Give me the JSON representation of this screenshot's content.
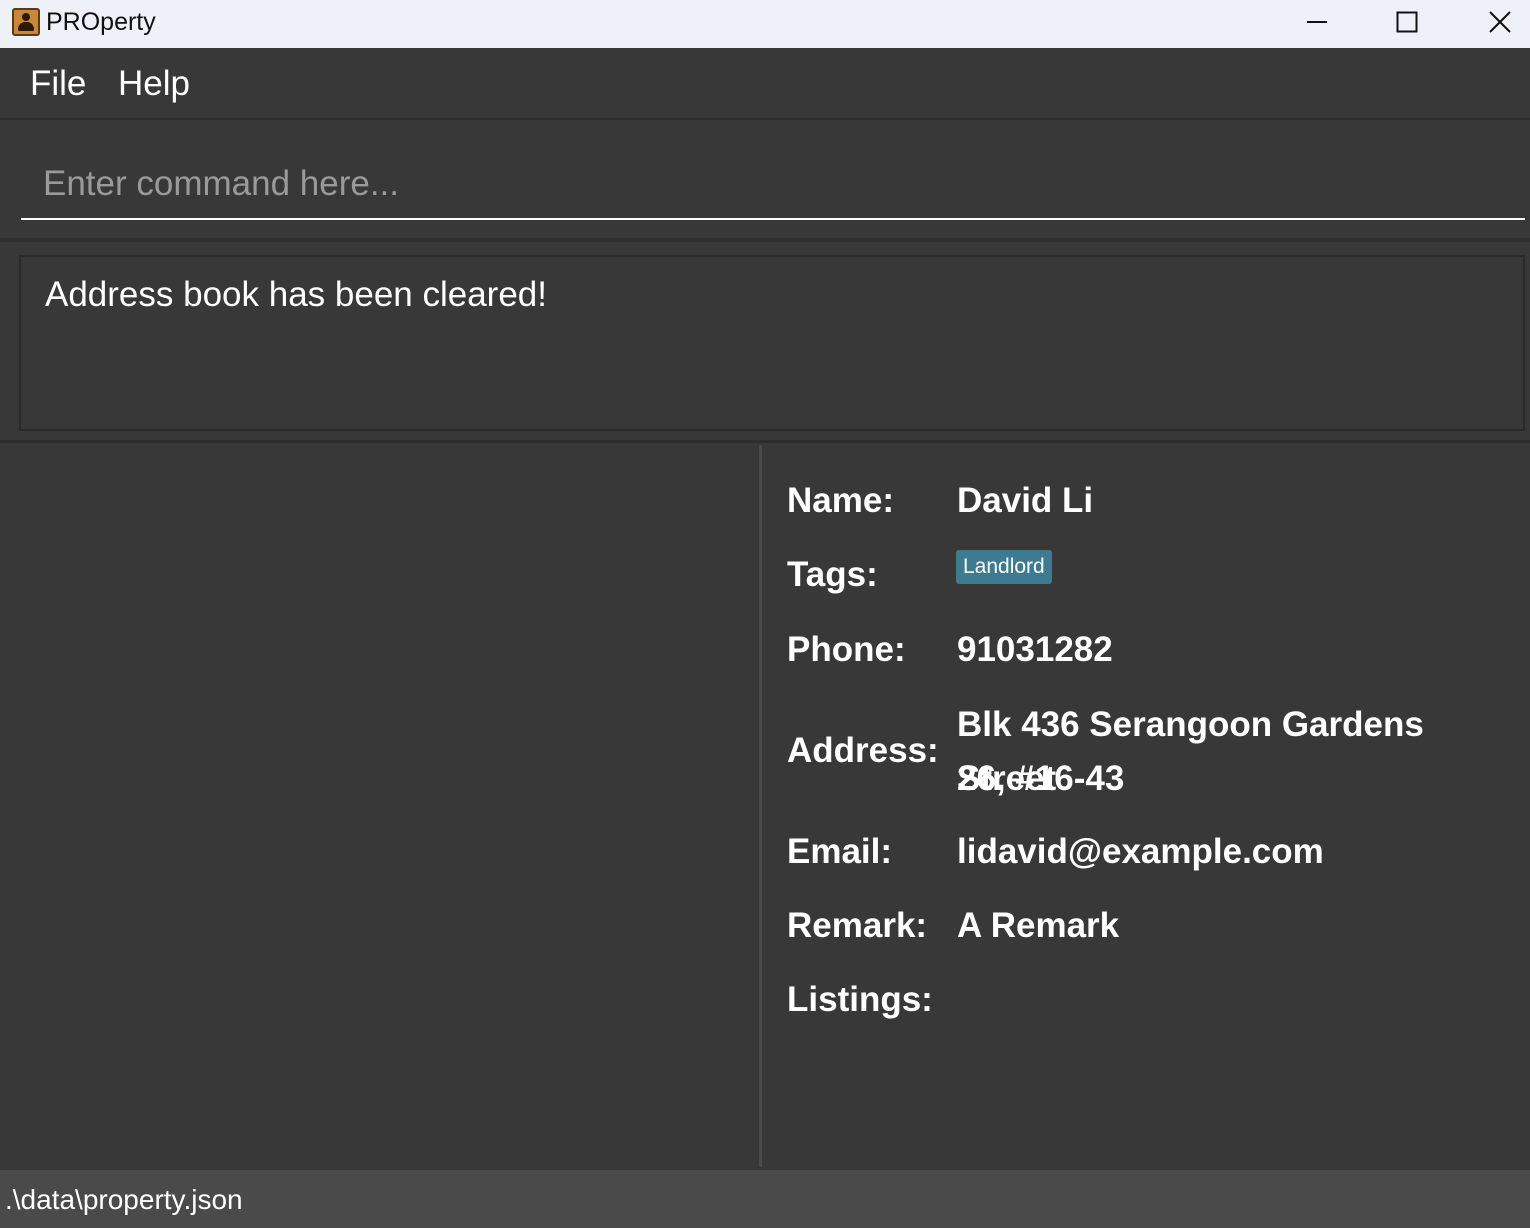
{
  "window": {
    "title": "PROperty",
    "icon": "address-book-icon",
    "controls": [
      "minimize-icon",
      "maximize-icon",
      "close-icon"
    ]
  },
  "menu": {
    "file": "File",
    "help": "Help"
  },
  "command": {
    "placeholder": "Enter command here...",
    "value": ""
  },
  "result": {
    "message": "Address book has been cleared!"
  },
  "person": {
    "labels": {
      "name": "Name:",
      "tags": "Tags:",
      "phone": "Phone:",
      "address": "Address:",
      "email": "Email:",
      "remark": "Remark:",
      "listings": "Listings:"
    },
    "name": "David Li",
    "tags": [
      "Landlord"
    ],
    "phone": "91031282",
    "address_line1": "Blk 436 Serangoon Gardens Street",
    "address_line2": "26, #16-43",
    "email": "lidavid@example.com",
    "remark": "A Remark",
    "listings": ""
  },
  "status": {
    "file_path": ".\\data\\property.json"
  },
  "colors": {
    "background": "#383838",
    "titlebar": "#eef2f8",
    "tag": "#3e7b91",
    "statusbar": "#4a4a4a",
    "text": "#ffffff"
  }
}
